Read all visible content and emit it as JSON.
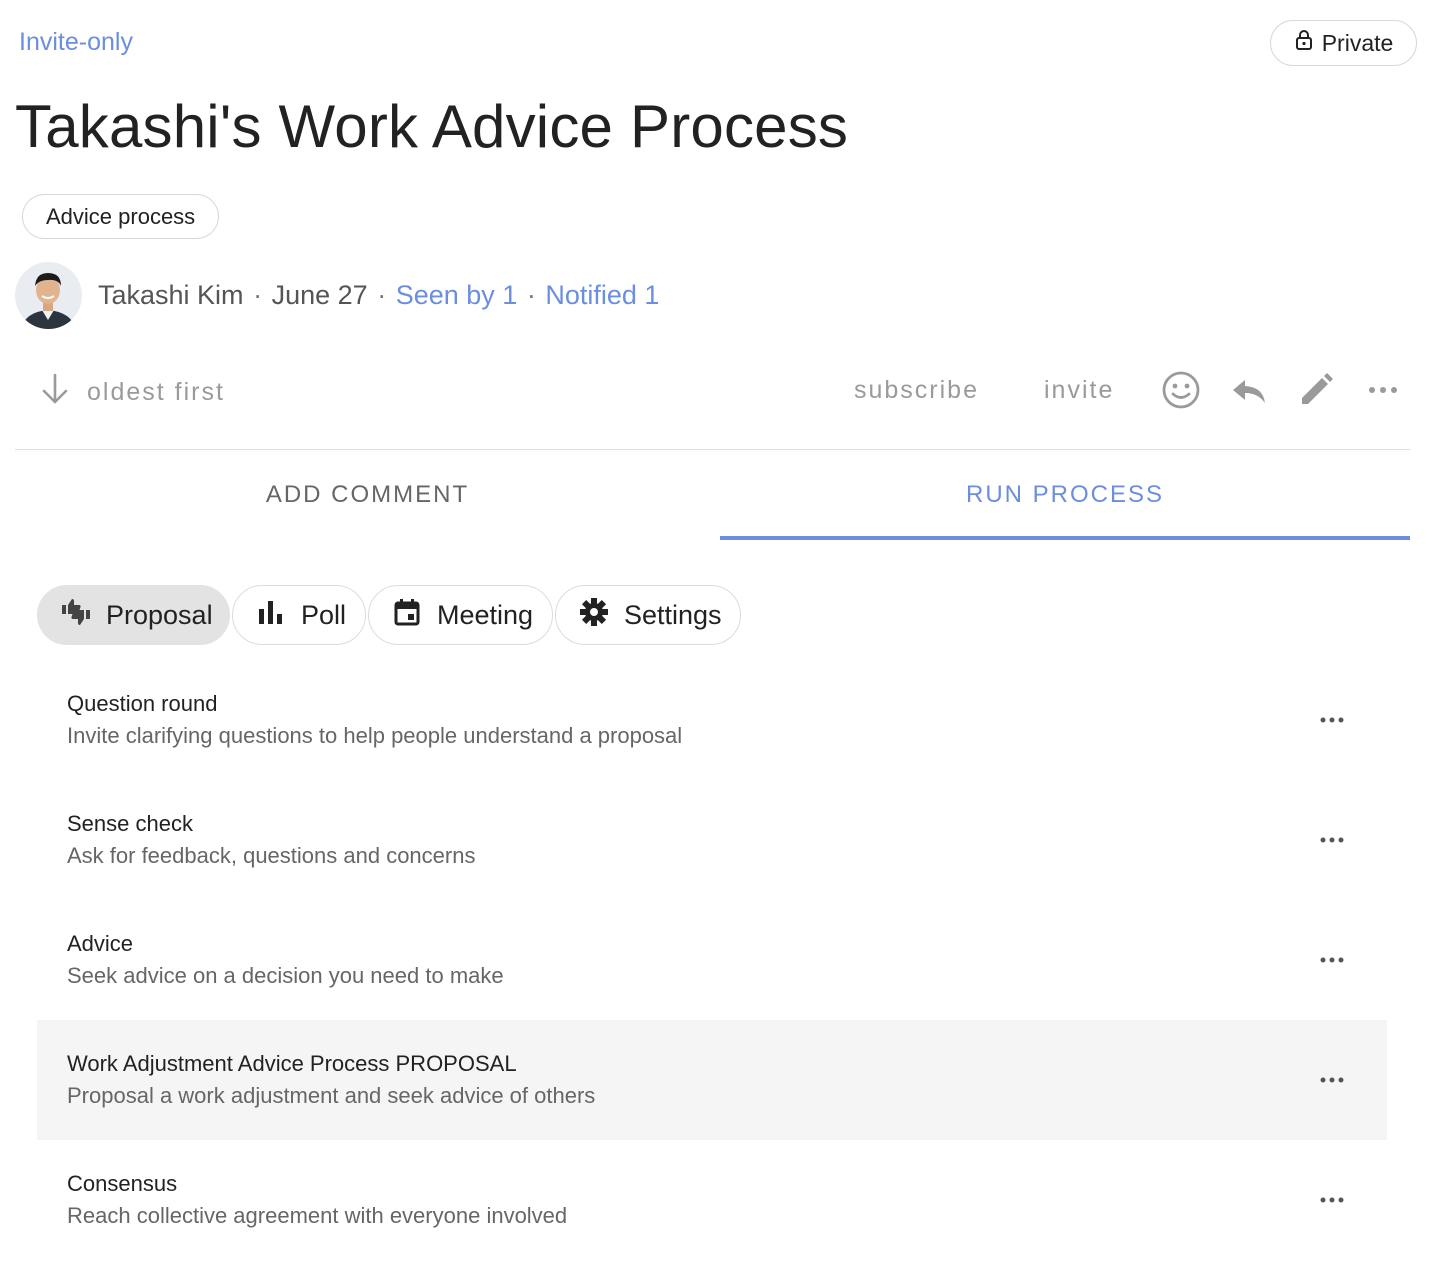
{
  "header": {
    "visibility_link": "Invite-only",
    "privacy_button": "Private",
    "title": "Takashi's Work Advice Process",
    "tag": "Advice process"
  },
  "author": {
    "name": "Takashi Kim",
    "date": "June 27",
    "seen_by": "Seen by 1",
    "notified": "Notified 1",
    "separator": "·"
  },
  "actions": {
    "sort_label": "oldest first",
    "subscribe_label": "subscribe",
    "invite_label": "invite",
    "icons": [
      "smiley-icon",
      "reply-icon",
      "pencil-icon",
      "more-horiz-icon"
    ]
  },
  "tabs": [
    {
      "label": "ADD COMMENT",
      "active": false
    },
    {
      "label": "RUN PROCESS",
      "active": true
    }
  ],
  "process_types": [
    {
      "label": "Proposal",
      "icon": "thumbs-up-down-icon",
      "active": true
    },
    {
      "label": "Poll",
      "icon": "bar-chart-icon",
      "active": false
    },
    {
      "label": "Meeting",
      "icon": "calendar-icon",
      "active": false
    },
    {
      "label": "Settings",
      "icon": "gear-icon",
      "active": false
    }
  ],
  "templates": [
    {
      "title": "Question round",
      "description": "Invite clarifying questions to help people understand a proposal",
      "highlighted": false
    },
    {
      "title": "Sense check",
      "description": "Ask for feedback, questions and concerns",
      "highlighted": false
    },
    {
      "title": "Advice",
      "description": "Seek advice on a decision you need to make",
      "highlighted": false
    },
    {
      "title": "Work Adjustment Advice Process PROPOSAL",
      "description": "Proposal a work adjustment and seek advice of others",
      "highlighted": true
    },
    {
      "title": "Consensus",
      "description": "Reach collective agreement with everyone involved",
      "highlighted": false
    }
  ],
  "colors": {
    "accent": "#6c8ee0",
    "muted": "#9a9a9a",
    "highlight_row": "#f5f5f5",
    "active_chip": "#e3e3e3"
  }
}
